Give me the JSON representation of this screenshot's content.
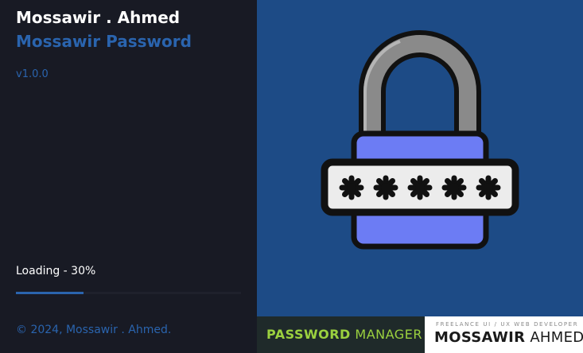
{
  "app": {
    "title": "Mossawir . Ahmed",
    "subtitle": "Mossawir Password",
    "version": "v1.0.0"
  },
  "loading": {
    "label": "Loading - 30%",
    "progress": 0.3
  },
  "footer": {
    "copyright": "© 2024, Mossawir . Ahmed."
  },
  "banner": {
    "product_strong": "PASSWORD",
    "product_light": "MANAGER",
    "tagline": "FREELANCE UI / UX WEB DEVELOPER",
    "brand_bold": "MOSSAWIR",
    "brand_light": "AHMED"
  },
  "colors": {
    "accent": "#2a64ae",
    "lock_body": "#6c7cf4",
    "shackle": "#8a8a8a",
    "panel_bg": "#1d4b86",
    "product_green": "#9bd13f"
  },
  "icons": {
    "hero": "padlock-password-icon"
  }
}
